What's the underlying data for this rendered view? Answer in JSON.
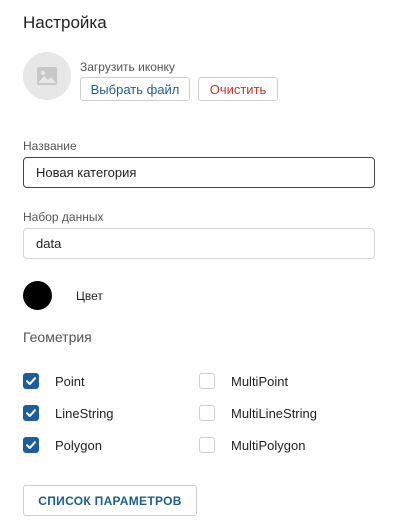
{
  "panel": {
    "title": "Настройка"
  },
  "icon_upload": {
    "label": "Загрузить иконку",
    "choose_button": "Выбрать файл",
    "clear_button": "Очистить"
  },
  "name_field": {
    "label": "Название",
    "value": "Новая категория"
  },
  "dataset_field": {
    "label": "Набор данных",
    "value": "data"
  },
  "color": {
    "label": "Цвет",
    "value": "#000000"
  },
  "geometry": {
    "label": "Геометрия",
    "options": [
      {
        "label": "Point",
        "checked": true
      },
      {
        "label": "MultiPoint",
        "checked": false
      },
      {
        "label": "LineString",
        "checked": true
      },
      {
        "label": "MultiLineString",
        "checked": false
      },
      {
        "label": "Polygon",
        "checked": true
      },
      {
        "label": "MultiPolygon",
        "checked": false
      }
    ]
  },
  "params_button": {
    "label": "СПИСОК ПАРАМЕТРОВ"
  },
  "colors": {
    "accent": "#1b5e9a",
    "danger": "#d32f2f"
  }
}
